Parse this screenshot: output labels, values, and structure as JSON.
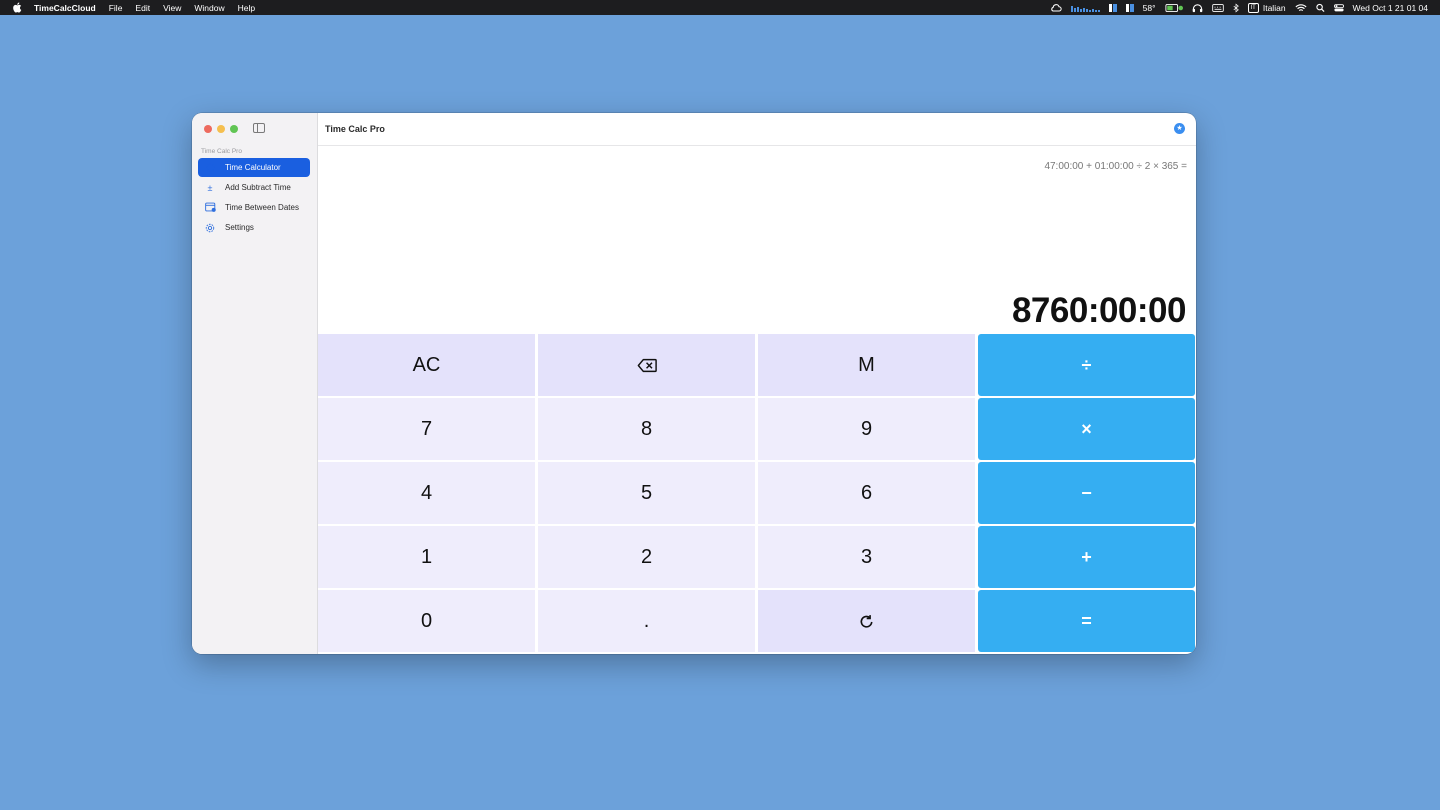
{
  "menubar": {
    "app_name": "TimeCalcCloud",
    "menus": [
      "File",
      "Edit",
      "View",
      "Window",
      "Help"
    ],
    "temperature": "58°",
    "keyboard_badge": "IT",
    "language": "Italian",
    "datetime": "Wed Oct 1  21 01 04",
    "icons": [
      "apple-icon",
      "cloud-sync-icon",
      "cpu-graph-icon",
      "memory-icon",
      "disk-icon",
      "battery-icon",
      "headphones-icon",
      "keyboard-icon",
      "bluetooth-icon",
      "wifi-icon",
      "search-icon",
      "control-center-icon"
    ]
  },
  "sidebar": {
    "section_label": "Time Calc Pro",
    "items": [
      {
        "label": "Time Calculator",
        "icon": "clock-icon",
        "active": true
      },
      {
        "label": "Add Subtract Time",
        "icon": "plus-minus-icon",
        "active": false
      },
      {
        "label": "Time Between Dates",
        "icon": "calendar-icon",
        "active": false
      },
      {
        "label": "Settings",
        "icon": "gear-icon",
        "active": false
      }
    ]
  },
  "window": {
    "title": "Time Calc Pro",
    "toolbar_icon": "star-badge-icon"
  },
  "display": {
    "expression": "47:00:00 + 01:00:00 ÷ 2 × 365 =",
    "result": "8760:00:00"
  },
  "keypad": {
    "row1": [
      "AC",
      "",
      "M",
      "÷"
    ],
    "row2": [
      "7",
      "8",
      "9",
      "×"
    ],
    "row3": [
      "4",
      "5",
      "6",
      "−"
    ],
    "row4": [
      "1",
      "2",
      "3",
      "+"
    ],
    "row5": [
      "0",
      ".",
      "",
      "="
    ],
    "backspace_icon": "delete-backward-icon",
    "cycle_icon": "rotate-icon"
  },
  "colors": {
    "desktop": "#6ca1da",
    "accent": "#1a5fe0",
    "operator": "#35aef2",
    "function_key": "#e4e2fb",
    "number_key": "#efedfc"
  }
}
